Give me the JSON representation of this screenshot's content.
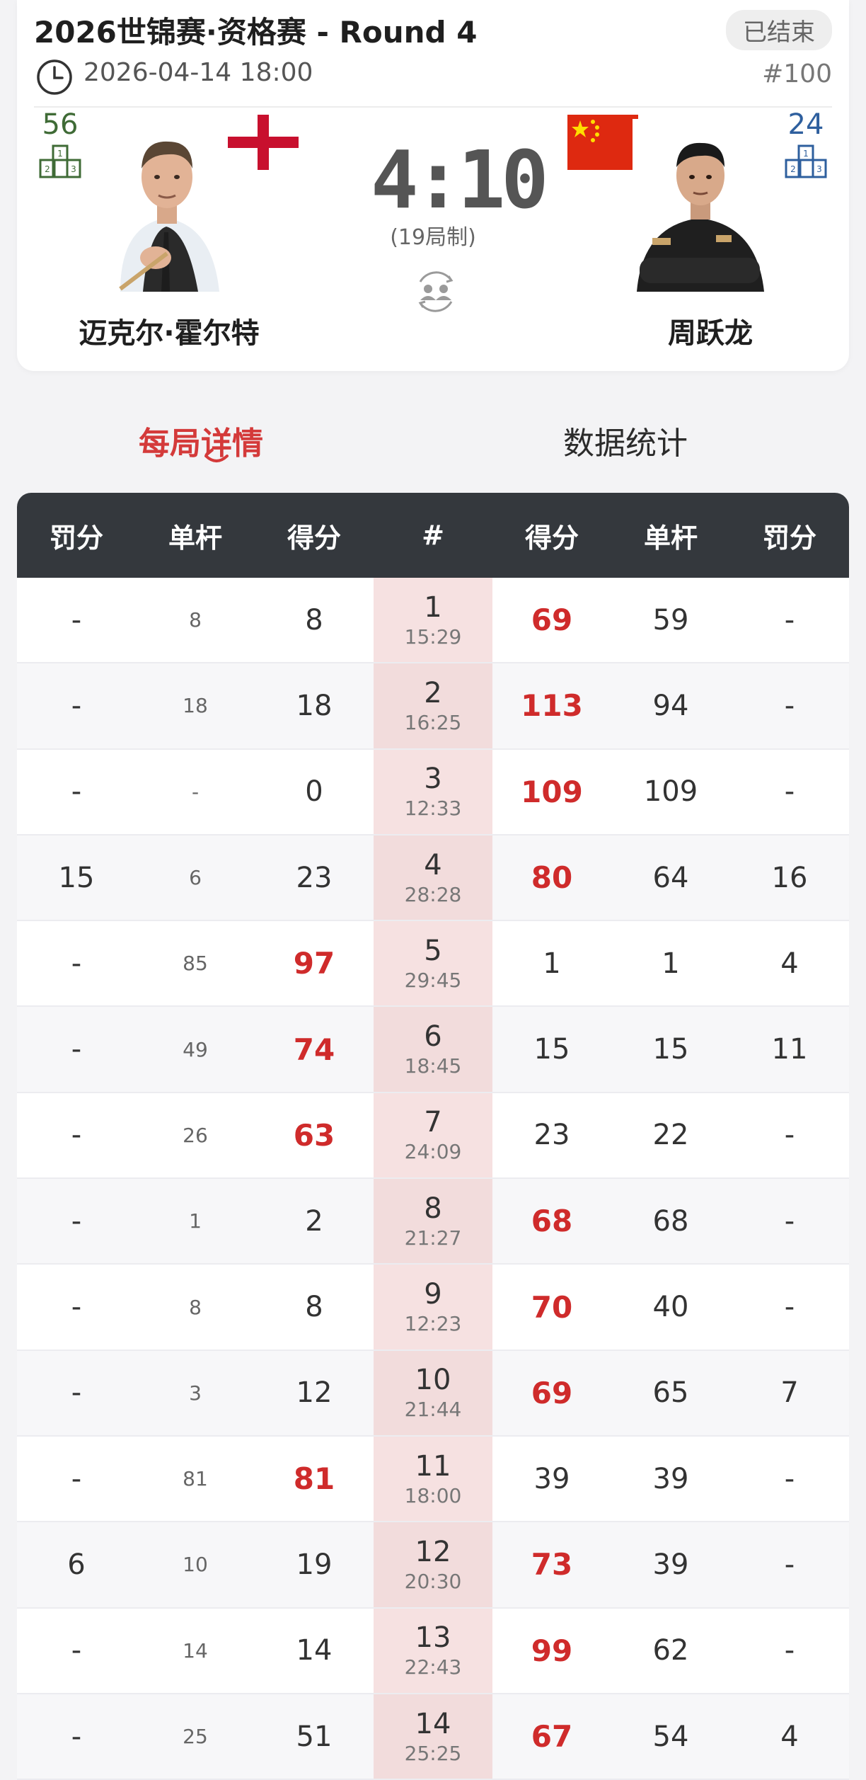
{
  "match": {
    "title": "2026世锦赛·资格赛 - Round 4",
    "status": "已结束",
    "datetime": "2026-04-14 18:00",
    "match_no": "#100",
    "score": "4:10",
    "format": "(19局制)"
  },
  "players": {
    "left": {
      "name": "迈克尔·霍尔特",
      "rank": "56",
      "flag": "england"
    },
    "right": {
      "name": "周跃龙",
      "rank": "24",
      "flag": "china"
    }
  },
  "tabs": [
    {
      "label": "每局详情",
      "active": true
    },
    {
      "label": "数据统计",
      "active": false
    }
  ],
  "table": {
    "headers": [
      "罚分",
      "单杆",
      "得分",
      "#",
      "得分",
      "单杆",
      "罚分"
    ],
    "rows": [
      {
        "l_foul": "-",
        "l_break": "8",
        "l_score": "8",
        "frame": "1",
        "time": "15:29",
        "r_score": "69",
        "r_break": "59",
        "r_foul": "-",
        "winner": "right"
      },
      {
        "l_foul": "-",
        "l_break": "18",
        "l_score": "18",
        "frame": "2",
        "time": "16:25",
        "r_score": "113",
        "r_break": "94",
        "r_foul": "-",
        "winner": "right"
      },
      {
        "l_foul": "-",
        "l_break": "-",
        "l_score": "0",
        "frame": "3",
        "time": "12:33",
        "r_score": "109",
        "r_break": "109",
        "r_foul": "-",
        "winner": "right"
      },
      {
        "l_foul": "15",
        "l_break": "6",
        "l_score": "23",
        "frame": "4",
        "time": "28:28",
        "r_score": "80",
        "r_break": "64",
        "r_foul": "16",
        "winner": "right"
      },
      {
        "l_foul": "-",
        "l_break": "85",
        "l_score": "97",
        "frame": "5",
        "time": "29:45",
        "r_score": "1",
        "r_break": "1",
        "r_foul": "4",
        "winner": "left"
      },
      {
        "l_foul": "-",
        "l_break": "49",
        "l_score": "74",
        "frame": "6",
        "time": "18:45",
        "r_score": "15",
        "r_break": "15",
        "r_foul": "11",
        "winner": "left"
      },
      {
        "l_foul": "-",
        "l_break": "26",
        "l_score": "63",
        "frame": "7",
        "time": "24:09",
        "r_score": "23",
        "r_break": "22",
        "r_foul": "-",
        "winner": "left"
      },
      {
        "l_foul": "-",
        "l_break": "1",
        "l_score": "2",
        "frame": "8",
        "time": "21:27",
        "r_score": "68",
        "r_break": "68",
        "r_foul": "-",
        "winner": "right"
      },
      {
        "l_foul": "-",
        "l_break": "8",
        "l_score": "8",
        "frame": "9",
        "time": "12:23",
        "r_score": "70",
        "r_break": "40",
        "r_foul": "-",
        "winner": "right"
      },
      {
        "l_foul": "-",
        "l_break": "3",
        "l_score": "12",
        "frame": "10",
        "time": "21:44",
        "r_score": "69",
        "r_break": "65",
        "r_foul": "7",
        "winner": "right"
      },
      {
        "l_foul": "-",
        "l_break": "81",
        "l_score": "81",
        "frame": "11",
        "time": "18:00",
        "r_score": "39",
        "r_break": "39",
        "r_foul": "-",
        "winner": "left"
      },
      {
        "l_foul": "6",
        "l_break": "10",
        "l_score": "19",
        "frame": "12",
        "time": "20:30",
        "r_score": "73",
        "r_break": "39",
        "r_foul": "-",
        "winner": "right"
      },
      {
        "l_foul": "-",
        "l_break": "14",
        "l_score": "14",
        "frame": "13",
        "time": "22:43",
        "r_score": "99",
        "r_break": "62",
        "r_foul": "-",
        "winner": "right"
      },
      {
        "l_foul": "-",
        "l_break": "25",
        "l_score": "51",
        "frame": "14",
        "time": "25:25",
        "r_score": "67",
        "r_break": "54",
        "r_foul": "4",
        "winner": "right"
      }
    ]
  },
  "colors": {
    "accent": "#d43a3a",
    "header_bg": "#34383d",
    "frame_bg": "#f6e1e1"
  }
}
